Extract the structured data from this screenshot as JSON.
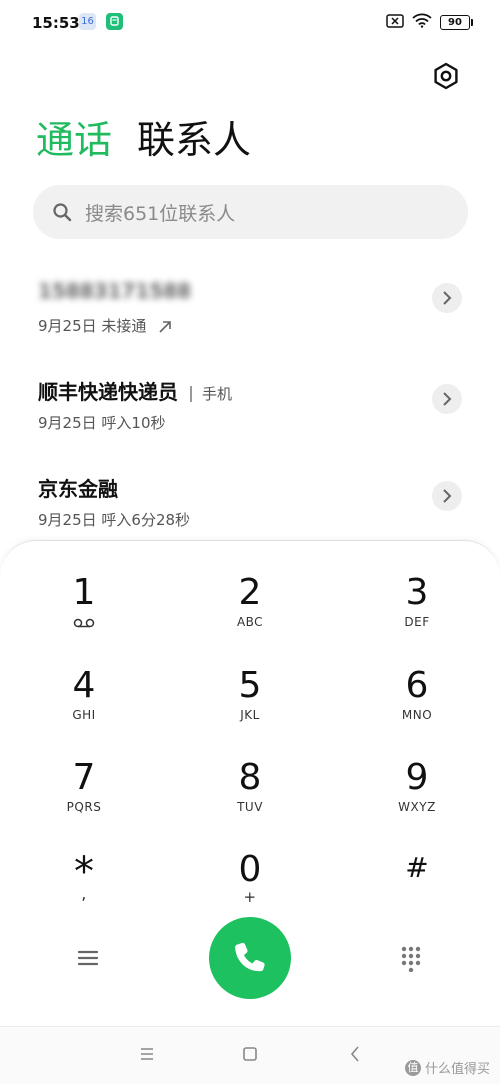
{
  "status_bar": {
    "time": "15:53",
    "badge1": "16",
    "battery": "90"
  },
  "tabs": {
    "calls": "通话",
    "contacts": "联系人"
  },
  "search": {
    "placeholder": "搜索651位联系人"
  },
  "call_log": [
    {
      "name": "15883171588",
      "date": "9月25日",
      "status": "未接通",
      "type": ""
    },
    {
      "name": "顺丰快递快递员",
      "type": "手机",
      "date": "9月25日",
      "status": "呼入10秒"
    },
    {
      "name": "京东金融",
      "type": "",
      "date": "9月25日",
      "status": "呼入6分28秒"
    }
  ],
  "keypad": {
    "keys": [
      {
        "digit": "1",
        "letters": ""
      },
      {
        "digit": "2",
        "letters": "ABC"
      },
      {
        "digit": "3",
        "letters": "DEF"
      },
      {
        "digit": "4",
        "letters": "GHI"
      },
      {
        "digit": "5",
        "letters": "JKL"
      },
      {
        "digit": "6",
        "letters": "MNO"
      },
      {
        "digit": "7",
        "letters": "PQRS"
      },
      {
        "digit": "8",
        "letters": "TUV"
      },
      {
        "digit": "9",
        "letters": "WXYZ"
      },
      {
        "digit": "*",
        "letters": ","
      },
      {
        "digit": "0",
        "letters": "+"
      },
      {
        "digit": "#",
        "letters": ""
      }
    ]
  },
  "colors": {
    "accent": "#1fbb5e",
    "call_button": "#1ec15f"
  },
  "watermark": {
    "text": "什么值得买",
    "logo": "值"
  },
  "icons": [
    "settings-icon",
    "search-icon",
    "chevron-right-icon",
    "missed-call-arrow-icon",
    "voicemail-icon",
    "menu-icon",
    "phone-icon",
    "dialpad-icon",
    "nav-recents-icon",
    "nav-home-icon",
    "nav-back-icon",
    "wifi-icon",
    "mute-icon"
  ]
}
